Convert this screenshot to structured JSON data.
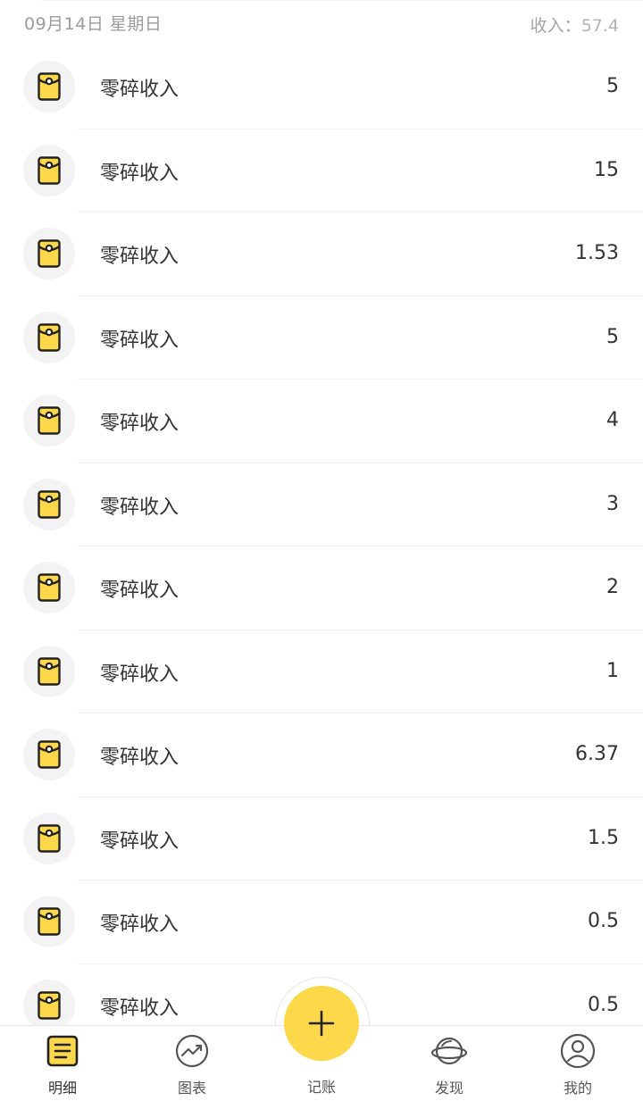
{
  "header": {
    "date": "09月14日 星期日",
    "income_label": "收入：",
    "income_value": "57.4"
  },
  "colors": {
    "accent": "#fcd84a",
    "icon_bg": "#f3f3f3",
    "text": "#333333",
    "muted": "#9b9b9b"
  },
  "entries": [
    {
      "category": "零碎收入",
      "amount": "5",
      "icon": "red-envelope-icon"
    },
    {
      "category": "零碎收入",
      "amount": "15",
      "icon": "red-envelope-icon"
    },
    {
      "category": "零碎收入",
      "amount": "1.53",
      "icon": "red-envelope-icon"
    },
    {
      "category": "零碎收入",
      "amount": "5",
      "icon": "red-envelope-icon"
    },
    {
      "category": "零碎收入",
      "amount": "4",
      "icon": "red-envelope-icon"
    },
    {
      "category": "零碎收入",
      "amount": "3",
      "icon": "red-envelope-icon"
    },
    {
      "category": "零碎收入",
      "amount": "2",
      "icon": "red-envelope-icon"
    },
    {
      "category": "零碎收入",
      "amount": "1",
      "icon": "red-envelope-icon"
    },
    {
      "category": "零碎收入",
      "amount": "6.37",
      "icon": "red-envelope-icon"
    },
    {
      "category": "零碎收入",
      "amount": "1.5",
      "icon": "red-envelope-icon"
    },
    {
      "category": "零碎收入",
      "amount": "0.5",
      "icon": "red-envelope-icon"
    },
    {
      "category": "零碎收入",
      "amount": "0.5",
      "icon": "red-envelope-icon"
    }
  ],
  "tabbar": {
    "tabs": [
      {
        "label": "明细",
        "icon": "details-list-icon",
        "active": true
      },
      {
        "label": "图表",
        "icon": "chart-trend-icon",
        "active": false
      },
      {
        "label": "记账",
        "icon": "plus-icon",
        "active": false
      },
      {
        "label": "发现",
        "icon": "planet-icon",
        "active": false
      },
      {
        "label": "我的",
        "icon": "user-profile-icon",
        "active": false
      }
    ]
  }
}
